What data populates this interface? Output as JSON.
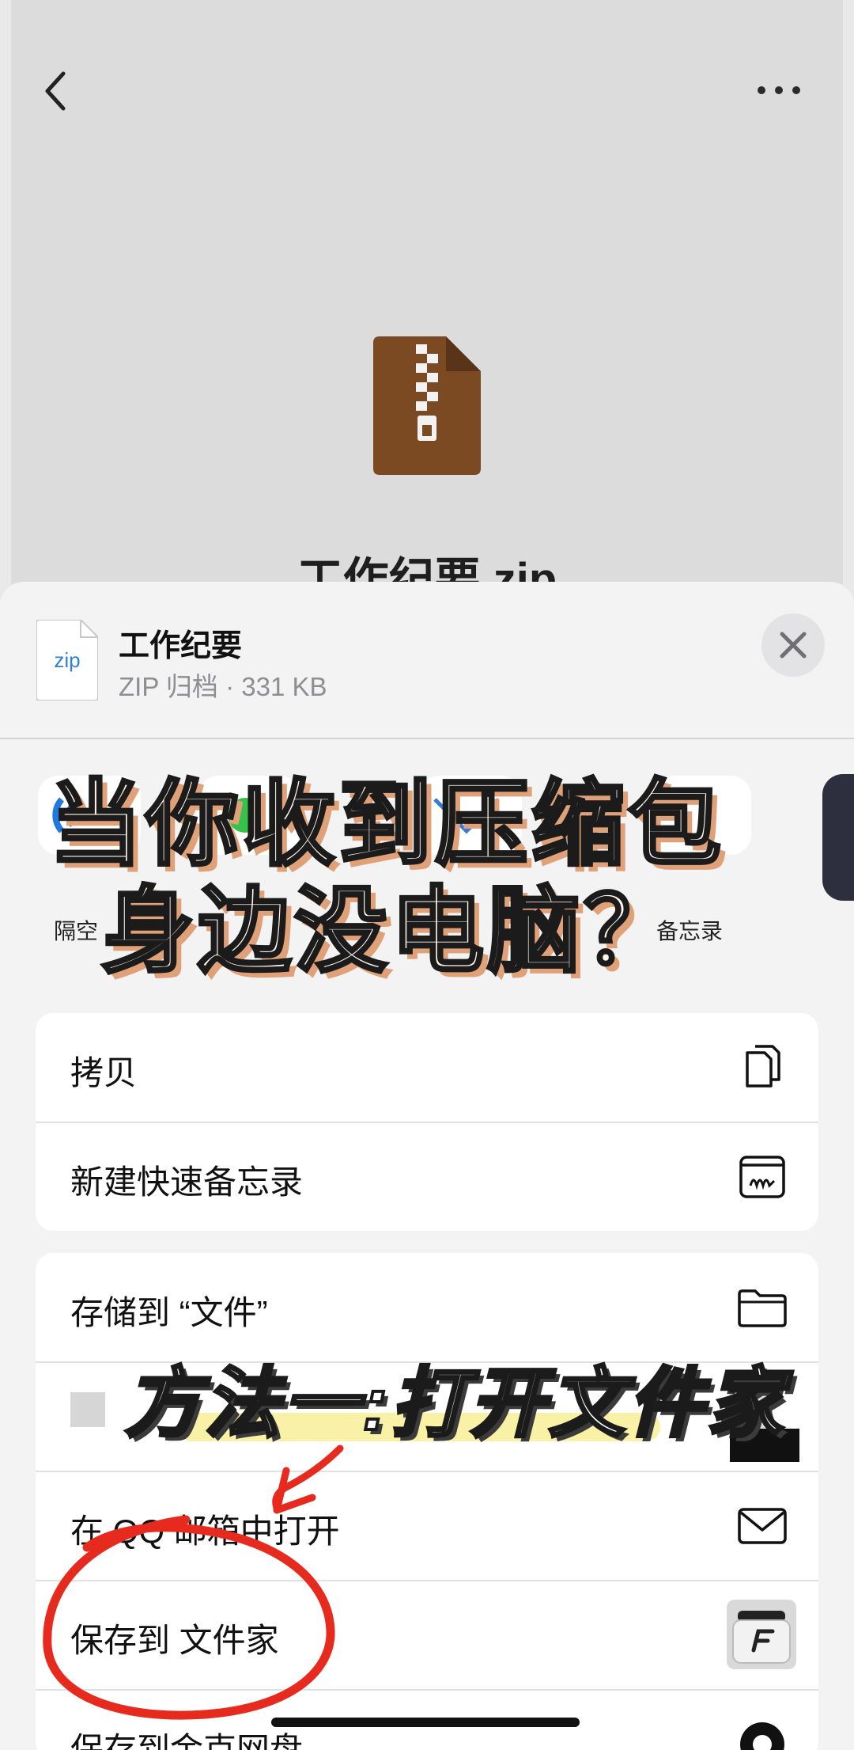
{
  "preview": {
    "filename": "工作纪要.zip",
    "colors": {
      "zip_icon": "#7b4a23",
      "background": "#dcdcdc"
    }
  },
  "sheet": {
    "file_name": "工作纪要",
    "file_meta": "ZIP 归档 · 331 KB",
    "thumb_label": "zip",
    "apps": {
      "left_label": "隔空",
      "right_label": "备忘录"
    },
    "group1": [
      {
        "label": "拷贝",
        "icon": "copy-icon"
      },
      {
        "label": "新建快速备忘录",
        "icon": "quick-note-icon"
      }
    ],
    "group2": [
      {
        "label": "存储到 “文件”",
        "icon": "folder-icon"
      },
      {
        "label": "",
        "icon": "redacted-icon"
      },
      {
        "label": "在 QQ 邮箱中打开",
        "icon": "mail-icon"
      },
      {
        "label": "保存到 文件家",
        "icon": "wenjianjia-app-icon"
      },
      {
        "label": "保存到金克网盘",
        "icon": "cloud-app-icon"
      }
    ]
  },
  "captions": {
    "line1": "当你收到压缩包",
    "line2": "身边没电脑？",
    "method": "方法一:打开文件家"
  },
  "colors": {
    "annotation_red": "#e62b1e",
    "caption_shadow": "#e0a178",
    "highlight": "#f7ef9c"
  }
}
